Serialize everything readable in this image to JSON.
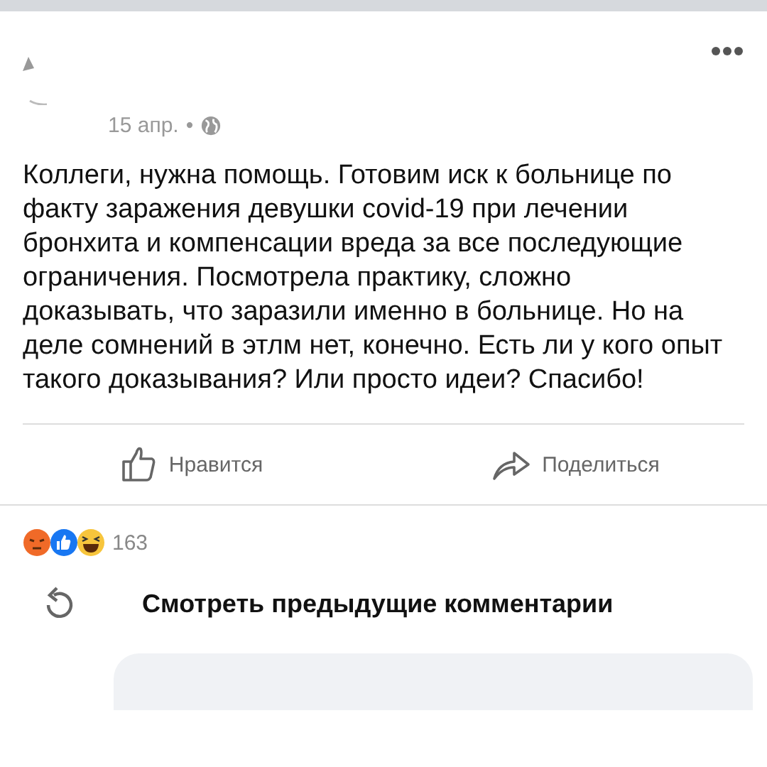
{
  "post": {
    "timestamp": "15 апр.",
    "separator": "•",
    "text": "Коллеги, нужна помощь. Готовим иск к больнице по факту заражения девушки covid-19 при лечении бронхита и компенсации вреда за все последующие ограничения. Посмотрела практику, сложно доказывать, что заразили именно в больнице. Но на деле сомнений в этлм нет, конечно. Есть ли у кого опыт такого доказывания? Или просто идеи? Спасибо!"
  },
  "actions": [
    {
      "kind": "like",
      "label": "Нравится"
    },
    {
      "kind": "share",
      "label": "Поделиться"
    }
  ],
  "reactions": {
    "types": [
      {
        "kind": "angry"
      },
      {
        "kind": "like"
      },
      {
        "kind": "haha"
      }
    ],
    "count": "163"
  },
  "comments": {
    "view_previous": "Смотреть предыдущие комментарии"
  }
}
